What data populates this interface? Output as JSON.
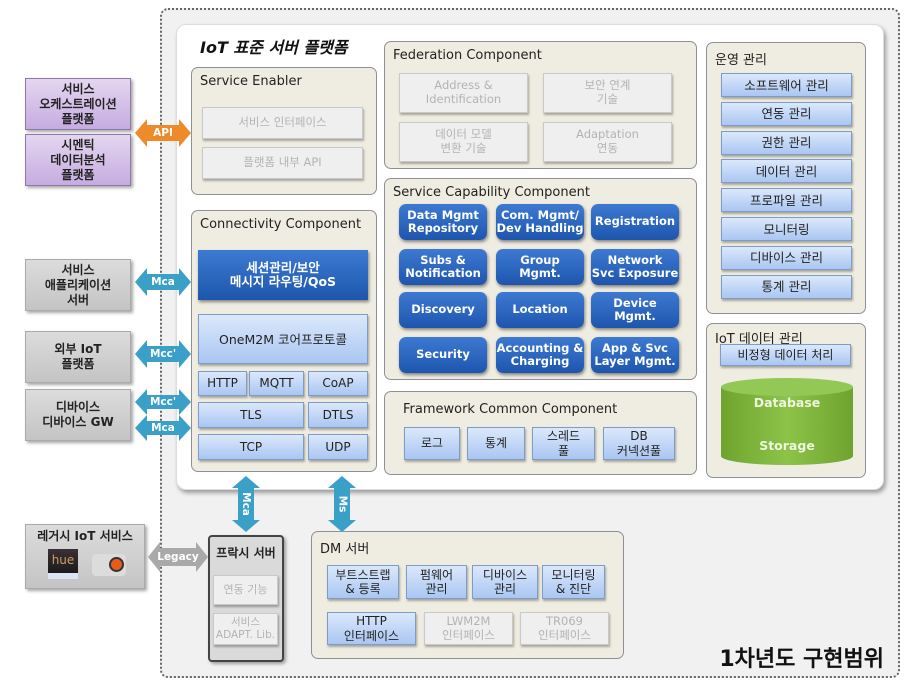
{
  "external_left": {
    "orchestration": "서비스\n오케스트레이션\n플랫폼",
    "semantic": "시멘틱\n데이터분석\n플랫폼",
    "app_server": "서비스\n애플리케이션\n서버",
    "external_iot": "외부 IoT\n플랫폼",
    "device": "디바이스\n디바이스 GW",
    "legacy_title": "레거시 IoT 서비스"
  },
  "arrows": {
    "api": "API",
    "mca_app": "Mca",
    "mcc_ext": "Mcc'",
    "mcc_dev": "Mcc'",
    "mca_dev": "Mca",
    "legacy": "Legacy",
    "mca_proxy": "Mca",
    "ms_dm": "Ms"
  },
  "platform": {
    "title": "IoT 표준 서버 플랫폼",
    "service_enabler": {
      "title": "Service Enabler",
      "items": [
        "서비스 인터페이스",
        "플랫폼 내부 API"
      ]
    },
    "connectivity": {
      "title": "Connectivity Component",
      "session": "세션관리/보안\n메시지 라우팅/QoS",
      "core": "OneM2M 코어프로토콜",
      "protocols": [
        "HTTP",
        "MQTT",
        "CoAP",
        "TLS",
        "DTLS",
        "TCP",
        "UDP"
      ]
    },
    "federation": {
      "title": "Federation Component",
      "items": [
        "Address &\nIdentification",
        "보안 연계\n기술",
        "데이터 모델\n변환 기술",
        "Adaptation\n연동"
      ]
    },
    "service_capability": {
      "title": "Service Capability Component",
      "items": [
        "Data Mgmt\nRepository",
        "Com. Mgmt/\nDev Handling",
        "Registration",
        "Subs &\nNotification",
        "Group\nMgmt.",
        "Network\nSvc Exposure",
        "Discovery",
        "Location",
        "Device Mgmt.",
        "Security",
        "Accounting &\nCharging",
        "App & Svc\nLayer Mgmt."
      ]
    },
    "framework_common": {
      "title": "Framework Common  Component",
      "items": [
        "로그",
        "통계",
        "스레드\n풀",
        "DB\n커넥션풀"
      ]
    },
    "operations": {
      "title": "운영 관리",
      "items": [
        "소프트웨어 관리",
        "연동 관리",
        "권한 관리",
        "데이터 관리",
        "프로파일 관리",
        "모니터링",
        "디바이스 관리",
        "통계 관리"
      ]
    },
    "iot_data": {
      "title": "IoT 데이터 관리",
      "unstructured": "비정형 데이터 처리",
      "database": "Database",
      "storage": "Storage"
    }
  },
  "proxy": {
    "title": "프락시 서버",
    "items": [
      "연동 기능",
      "서비스\nADAPT. Lib."
    ]
  },
  "dm_server": {
    "title": "DM 서버",
    "functions": [
      "부트스트랩\n& 등록",
      "펌웨어\n관리",
      "디바이스\n관리",
      "모니터링\n& 진단"
    ],
    "interfaces": [
      "HTTP\n인터페이스",
      "LWM2M\n인터페이스",
      "TR069\n인터페이스"
    ]
  },
  "scope_label": "1차년도 구현범위",
  "colors": {
    "api_arrow": "#ee8a2a",
    "blue_arrow": "#3aa0c8",
    "legacy_arrow": "#a9a9a9",
    "capability_blue": "#2560b8",
    "database_green": "#7bb23a"
  }
}
